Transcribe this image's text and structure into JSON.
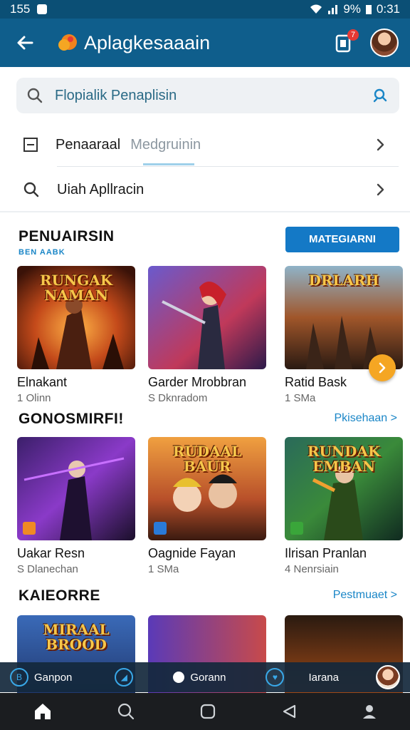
{
  "status_bar": {
    "time_left": "155",
    "battery": "9%",
    "clock": "0:31"
  },
  "app_bar": {
    "title": "Aplagkesaaain",
    "notification_count": "7"
  },
  "search": {
    "placeholder": "Flopialik Penaplisin"
  },
  "menu": {
    "row1_label": "Penaaraal",
    "row1_muted": "Medgruinin",
    "row2_label": "Uiah Apllracin"
  },
  "section1": {
    "title": "PENUAIRSIN",
    "subtitle": "BEN AABK",
    "button_label": "MATEGIARNI",
    "cards": [
      {
        "art_title": "RUNGAK NAMAN",
        "name": "Elnakant",
        "meta": "1 Olinn"
      },
      {
        "art_title": "",
        "name": "Garder Mrobbran",
        "meta": "S Dknradom"
      },
      {
        "art_title": "DRLARH",
        "name": "Ratid Bask",
        "meta": "1 SMa"
      }
    ]
  },
  "section2": {
    "title": "GONOSMIRFI!",
    "more_label": "Pkisehaan >",
    "cards": [
      {
        "art_title": "",
        "name": "Uakar Resn",
        "meta": "S Dlanechan"
      },
      {
        "art_title": "RUDAAL BAUR",
        "name": "Oagnide Fayan",
        "meta": "1 SMa"
      },
      {
        "art_title": "RUNDAK EMBAN",
        "name": "Ilrisan Pranlan",
        "meta": "4 Nenrsiain"
      }
    ]
  },
  "section3": {
    "title": "KAIEORRE",
    "more_label": "Pestmuaet >",
    "cards": [
      {
        "art_title": "MIRAAL BROOD"
      },
      {
        "art_title": ""
      },
      {
        "art_title": ""
      }
    ]
  },
  "mini_player": {
    "item1": "Ganpon",
    "item2": "Gorann",
    "item3": "Iarana"
  },
  "icons": {
    "back": "arrow-left-icon",
    "search": "search-icon",
    "camera": "camera-search-icon",
    "chevron": "chevron-right-icon",
    "home": "home-icon",
    "nav_search": "search-icon",
    "recents": "square-icon",
    "nav_back": "triangle-back-icon",
    "profile": "person-icon"
  },
  "colors": {
    "app_bar": "#0f5e8c",
    "accent": "#1479c6",
    "fab": "#f5a623"
  }
}
